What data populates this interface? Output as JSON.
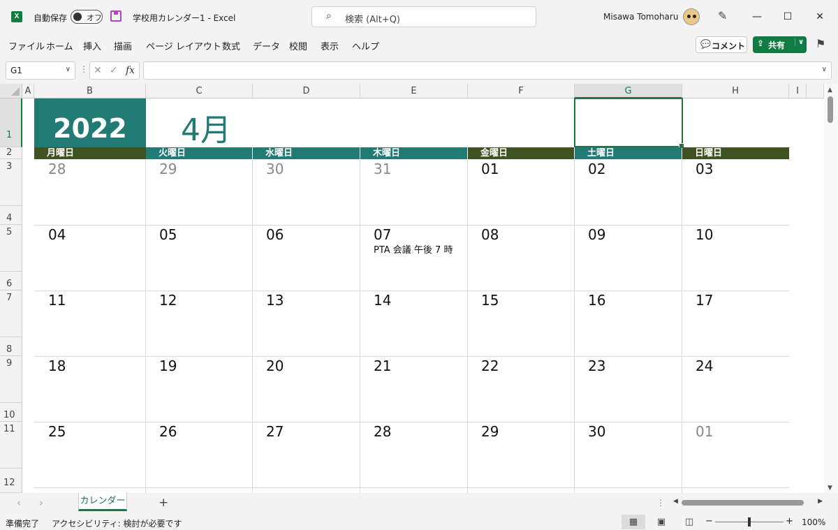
{
  "titlebar": {
    "logo": "X",
    "autosave_label": "自動保存",
    "autosave_state": "オフ",
    "doc_title": "学校用カレンダー1  -  Excel",
    "search_icon": "⌕",
    "search_placeholder": "検索 (Alt+Q)",
    "user_name": "Misawa Tomoharu",
    "pen_icon": "✎",
    "minimize": "—",
    "maximize": "☐",
    "close": "✕"
  },
  "menu": {
    "items": [
      "ファイル",
      "ホーム",
      "挿入",
      "描画",
      "ページ レイアウト",
      "数式",
      "データ",
      "校閲",
      "表示",
      "ヘルプ"
    ],
    "comment_label": "コメント",
    "comment_icon": "💬",
    "share_label": "共有",
    "share_icon": "⇪",
    "share_chevron": "∨",
    "feedback_icon": "⚑"
  },
  "formula_bar": {
    "name_box": "G1",
    "chevron": "∨",
    "dots": "⋮",
    "cancel_icon": "✕",
    "enter_icon": "✓",
    "fx_label": "fx",
    "formula": ""
  },
  "grid": {
    "columns": [
      "A",
      "B",
      "C",
      "D",
      "E",
      "F",
      "G",
      "H",
      "I"
    ],
    "rows": [
      "1",
      "2",
      "3",
      "4",
      "5",
      "6",
      "7",
      "8",
      "9",
      "10",
      "11",
      "12"
    ]
  },
  "calendar": {
    "year": "2022",
    "month": "4月",
    "weekdays": [
      "月曜日",
      "火曜日",
      "水曜日",
      "木曜日",
      "金曜日",
      "土曜日",
      "日曜日"
    ],
    "weeks": [
      [
        "28",
        "29",
        "30",
        "31",
        "01",
        "02",
        "03"
      ],
      [
        "04",
        "05",
        "06",
        "07",
        "08",
        "09",
        "10"
      ],
      [
        "11",
        "12",
        "13",
        "14",
        "15",
        "16",
        "17"
      ],
      [
        "18",
        "19",
        "20",
        "21",
        "22",
        "23",
        "24"
      ],
      [
        "25",
        "26",
        "27",
        "28",
        "29",
        "30",
        "01"
      ]
    ],
    "event": "PTA 会議 午後 7 時",
    "colors": {
      "teal": "#217a73",
      "olive": "#3f5322",
      "muted": "#888888"
    }
  },
  "sheet_tabs": {
    "prev": "‹",
    "next": "›",
    "active_tab": "カレンダー",
    "add": "+",
    "dots": "⋮"
  },
  "scroll": {
    "up": "▲",
    "down": "▼",
    "left": "◀",
    "right": "▶"
  },
  "status": {
    "ready": "準備完了",
    "accessibility": "アクセシビリティ: 検討が必要です",
    "zoom_minus": "−",
    "zoom_plus": "+",
    "zoom": "100%",
    "zoom_fraction": 0.5,
    "view_normal": "▦",
    "view_page_layout": "▣",
    "view_page_break": "◫"
  }
}
